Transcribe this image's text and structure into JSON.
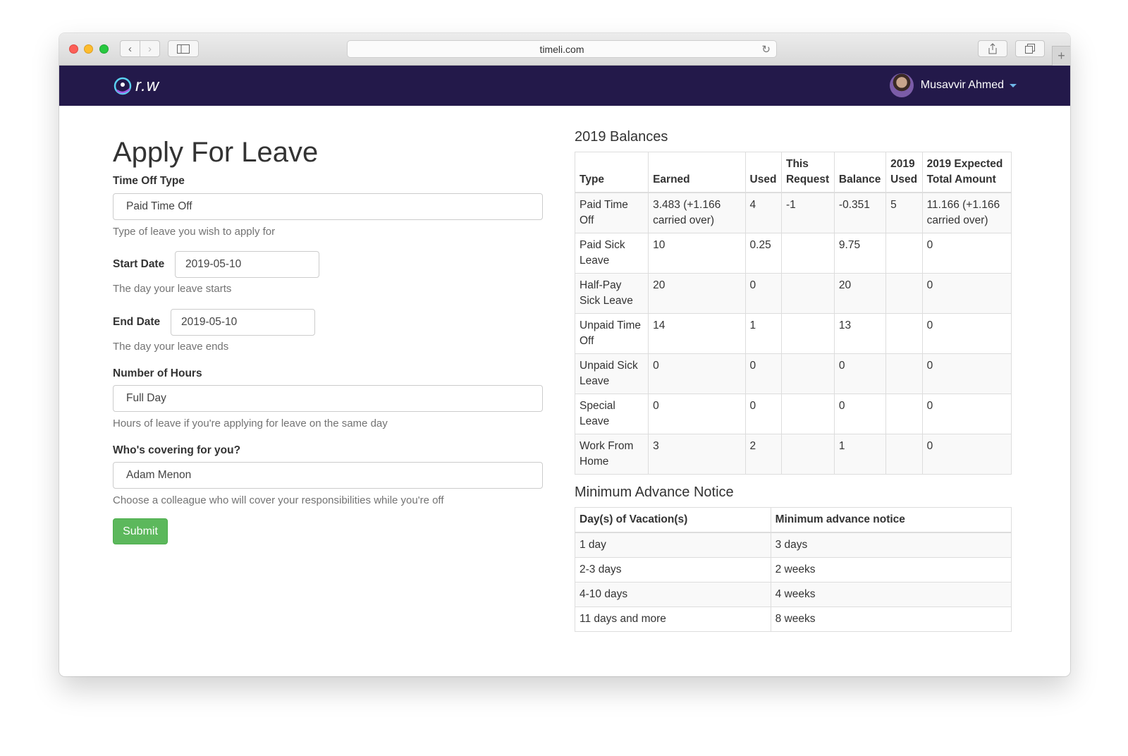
{
  "browser": {
    "url": "timeli.com"
  },
  "navbar": {
    "logo_text": "r.w",
    "user_name": "Musavvir Ahmed"
  },
  "form": {
    "title": "Apply For Leave",
    "time_off_type": {
      "label": "Time Off Type",
      "value": "Paid Time Off",
      "help": "Type of leave you wish to apply for"
    },
    "start_date": {
      "label": "Start Date",
      "value": "2019-05-10",
      "help": "The day your leave starts"
    },
    "end_date": {
      "label": "End Date",
      "value": "2019-05-10",
      "help": "The day your leave ends"
    },
    "hours": {
      "label": "Number of Hours",
      "value": "Full Day",
      "help": "Hours of leave if you're applying for leave on the same day"
    },
    "covering": {
      "label": "Who's covering for you?",
      "value": "Adam Menon",
      "help": "Choose a colleague who will cover your responsibilities while you're off"
    },
    "submit_label": "Submit"
  },
  "balances": {
    "title": "2019 Balances",
    "headers": [
      "Type",
      "Earned",
      "Used",
      "This Request",
      "Balance",
      "2019 Used",
      "2019 Expected Total Amount"
    ],
    "rows": [
      [
        "Paid Time Off",
        "3.483 (+1.166 carried over)",
        "4",
        "-1",
        "-0.351",
        "5",
        "11.166 (+1.166 carried over)"
      ],
      [
        "Paid Sick Leave",
        "10",
        "0.25",
        "",
        "9.75",
        "",
        "0"
      ],
      [
        "Half-Pay Sick Leave",
        "20",
        "0",
        "",
        "20",
        "",
        "0"
      ],
      [
        "Unpaid Time Off",
        "14",
        "1",
        "",
        "13",
        "",
        "0"
      ],
      [
        "Unpaid Sick Leave",
        "0",
        "0",
        "",
        "0",
        "",
        "0"
      ],
      [
        "Special Leave",
        "0",
        "0",
        "",
        "0",
        "",
        "0"
      ],
      [
        "Work From Home",
        "3",
        "2",
        "",
        "1",
        "",
        "0"
      ]
    ]
  },
  "notice": {
    "title": "Minimum Advance Notice",
    "headers": [
      "Day(s) of Vacation(s)",
      "Minimum advance notice"
    ],
    "rows": [
      [
        "1 day",
        "3 days"
      ],
      [
        "2-3 days",
        "2 weeks"
      ],
      [
        "4-10 days",
        "4 weeks"
      ],
      [
        "11 days and more",
        "8 weeks"
      ]
    ]
  }
}
